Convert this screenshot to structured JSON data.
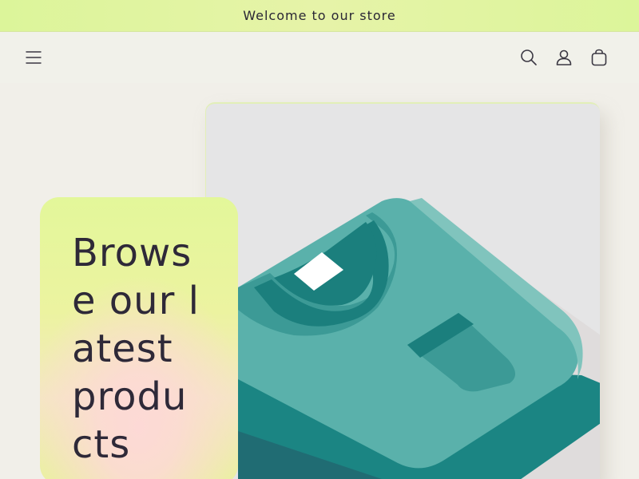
{
  "announcement": {
    "text": "Welcome to our store"
  },
  "header": {
    "menu_icon": "hamburger-menu-icon",
    "search_icon": "search-icon",
    "account_icon": "user-icon",
    "cart_icon": "cart-icon"
  },
  "hero": {
    "heading": "Browse our latest products",
    "image_icon": "folded-tshirt-illustration"
  },
  "colors": {
    "announcement_bg": "#dcf59a",
    "page_bg": "#f0efe9",
    "card_bg": "#e5e5e6",
    "text": "#2a2735",
    "shirt_teal": "#5ab1ab",
    "shirt_dark": "#197f7e"
  }
}
